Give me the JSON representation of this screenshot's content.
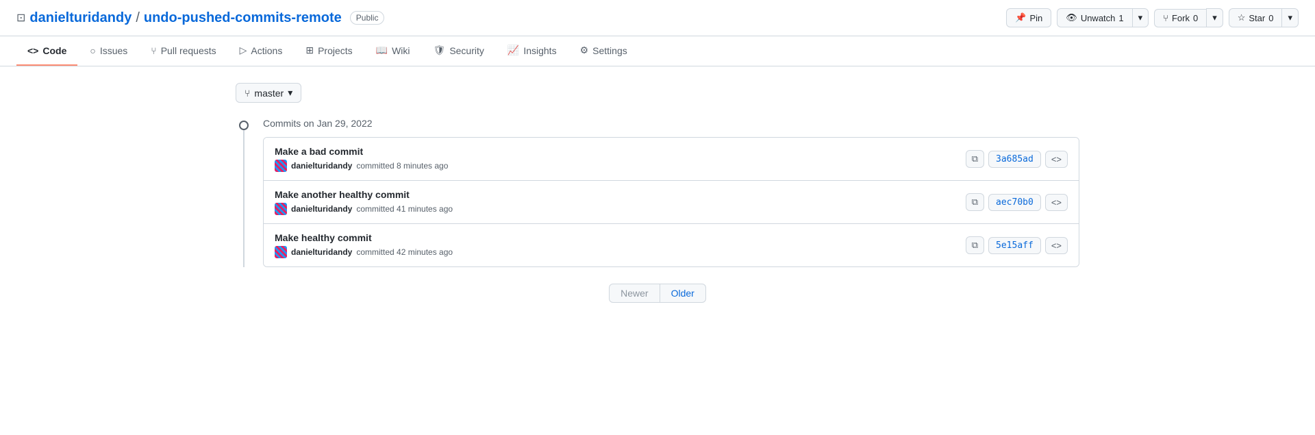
{
  "header": {
    "repo_icon": "⊡",
    "owner": "danielturidandy",
    "separator": "/",
    "repo_name": "undo-pushed-commits-remote",
    "visibility": "Public",
    "actions": {
      "pin": "Pin",
      "pin_icon": "📌",
      "unwatch": "Unwatch",
      "unwatch_icon": "👁",
      "unwatch_count": "1",
      "fork": "Fork",
      "fork_icon": "⑂",
      "fork_count": "0",
      "star": "Star",
      "star_icon": "☆",
      "star_count": "0"
    }
  },
  "nav": {
    "tabs": [
      {
        "id": "code",
        "label": "Code",
        "icon": "<>",
        "active": true
      },
      {
        "id": "issues",
        "label": "Issues",
        "icon": "○",
        "active": false
      },
      {
        "id": "pull-requests",
        "label": "Pull requests",
        "icon": "⑂",
        "active": false
      },
      {
        "id": "actions",
        "label": "Actions",
        "icon": "▷",
        "active": false
      },
      {
        "id": "projects",
        "label": "Projects",
        "icon": "⊞",
        "active": false
      },
      {
        "id": "wiki",
        "label": "Wiki",
        "icon": "📖",
        "active": false
      },
      {
        "id": "security",
        "label": "Security",
        "icon": "🛡",
        "active": false
      },
      {
        "id": "insights",
        "label": "Insights",
        "icon": "📈",
        "active": false
      },
      {
        "id": "settings",
        "label": "Settings",
        "icon": "⚙",
        "active": false
      }
    ]
  },
  "branch": {
    "label": "master",
    "icon": "⑂",
    "dropdown_icon": "▾"
  },
  "commits": {
    "date_label": "Commits on Jan 29, 2022",
    "items": [
      {
        "id": "commit-1",
        "message": "Make a bad commit",
        "author": "danielturidandy",
        "time": "committed 8 minutes ago",
        "sha": "3a685ad",
        "copy_title": "Copy full SHA for 3a685ad",
        "browse_title": "Browse the repository at this point in the history"
      },
      {
        "id": "commit-2",
        "message": "Make another healthy commit",
        "author": "danielturidandy",
        "time": "committed 41 minutes ago",
        "sha": "aec70b0",
        "copy_title": "Copy full SHA for aec70b0",
        "browse_title": "Browse the repository at this point in the history"
      },
      {
        "id": "commit-3",
        "message": "Make healthy commit",
        "author": "danielturidandy",
        "time": "committed 42 minutes ago",
        "sha": "5e15aff",
        "copy_title": "Copy full SHA for 5e15aff",
        "browse_title": "Browse the repository at this point in the history"
      }
    ]
  },
  "pagination": {
    "newer": "Newer",
    "older": "Older"
  }
}
